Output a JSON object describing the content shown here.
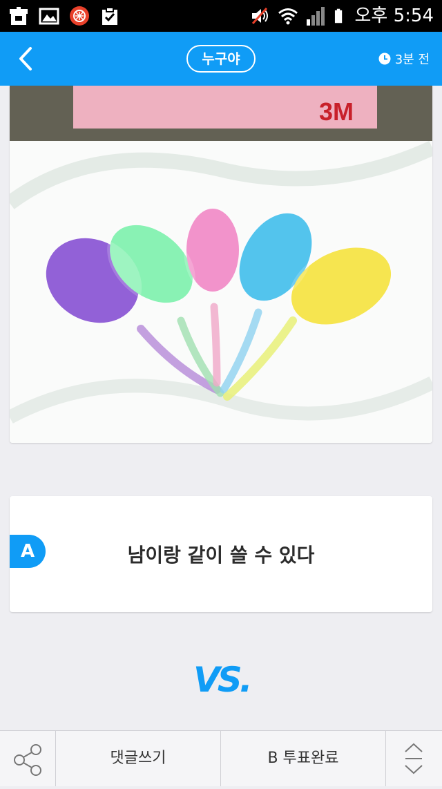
{
  "status_bar": {
    "time": "오후 5:54",
    "left_icons": [
      "store-icon",
      "gallery-icon",
      "app-icon",
      "clipboard-icon"
    ],
    "right_icons": [
      "mute-icon",
      "wifi-icon",
      "signal-icon",
      "battery-icon"
    ]
  },
  "app_bar": {
    "title": "누구야",
    "time_ago": "3분 전",
    "accent_color": "#109cf6"
  },
  "main": {
    "image_alt_visible": "3M",
    "option": {
      "badge": "A",
      "text": "남이랑 같이 쓸 수 있다"
    },
    "vs_label": "VS",
    "vs_dot": "."
  },
  "bottom_bar": {
    "comment_label": "댓글쓰기",
    "vote_label": "B 투표완료"
  }
}
